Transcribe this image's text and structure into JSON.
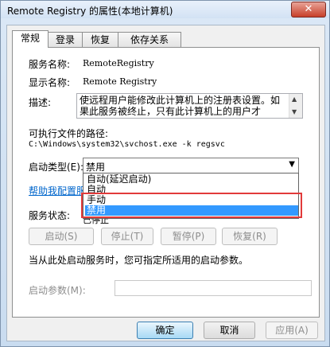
{
  "window": {
    "title": "Remote Registry 的属性(本地计算机)",
    "close_label": "✕"
  },
  "tabs": [
    {
      "label": "常规",
      "active": true
    },
    {
      "label": "登录",
      "active": false
    },
    {
      "label": "恢复",
      "active": false
    },
    {
      "label": "依存关系",
      "active": false
    }
  ],
  "general": {
    "service_name_label": "服务名称:",
    "service_name_value": "RemoteRegistry",
    "display_name_label": "显示名称:",
    "display_name_value": "Remote Registry",
    "description_label": "描述:",
    "description_text": "使远程用户能修改此计算机上的注册表设置。如果此服务被终止，只有此计算机上的用户才",
    "exe_path_label": "可执行文件的路径:",
    "exe_path_value": "C:\\Windows\\system32\\svchost.exe -k regsvc",
    "startup_type_label": "启动类型(E):",
    "startup_type_value": "禁用",
    "startup_options": [
      "自动(延迟启动)",
      "自动",
      "手动",
      "禁用"
    ],
    "help_link": "帮助我配置服务启",
    "service_status_label": "服务状态:",
    "service_status_value": "已停止",
    "start_button": "启动(S)",
    "stop_button": "停止(T)",
    "pause_button": "暂停(P)",
    "resume_button": "恢复(R)",
    "hint_text": "当从此处启动服务时，您可指定所适用的启动参数。",
    "start_params_label": "启动参数(M):",
    "start_params_value": ""
  },
  "footer": {
    "ok": "确定",
    "cancel": "取消",
    "apply": "应用(A)"
  },
  "colors": {
    "selection": "#3399ff",
    "highlight_box": "#e23a3a",
    "link": "#0066cc"
  }
}
